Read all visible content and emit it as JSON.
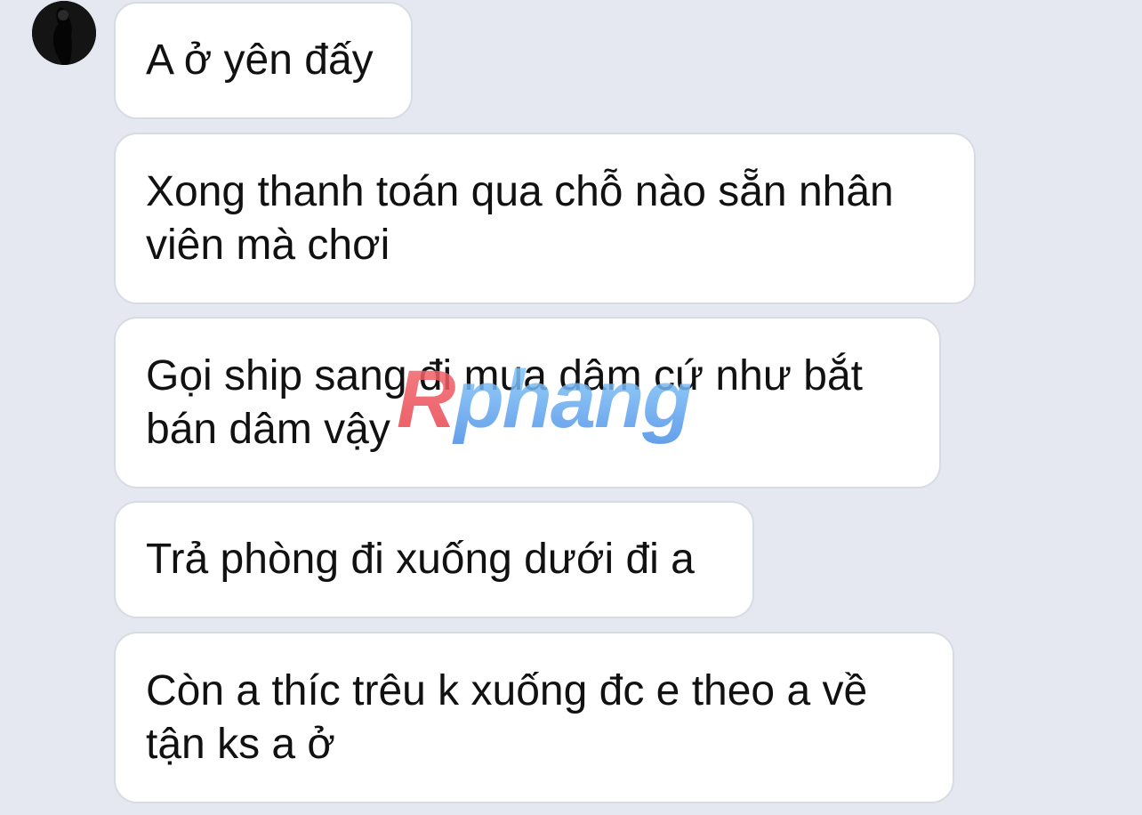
{
  "chat": {
    "sender_avatar_icon": "avatar-icon",
    "messages": [
      {
        "text": "A ở yên đấy"
      },
      {
        "text": "Xong thanh toán qua chỗ nào sẵn nhân\nviên mà chơi"
      },
      {
        "text": "Gọi ship sang đi mua dâm cứ như bắt\nbán dâm vậy"
      },
      {
        "text": "Trả phòng đi xuống dưới đi a"
      },
      {
        "text": "Còn a thíc trêu k xuống đc e theo a về\ntận ks a ở"
      }
    ]
  },
  "watermark": {
    "text": "Rphang",
    "colors": {
      "first": "#f0505a",
      "rest": "#5fa8f0"
    }
  }
}
